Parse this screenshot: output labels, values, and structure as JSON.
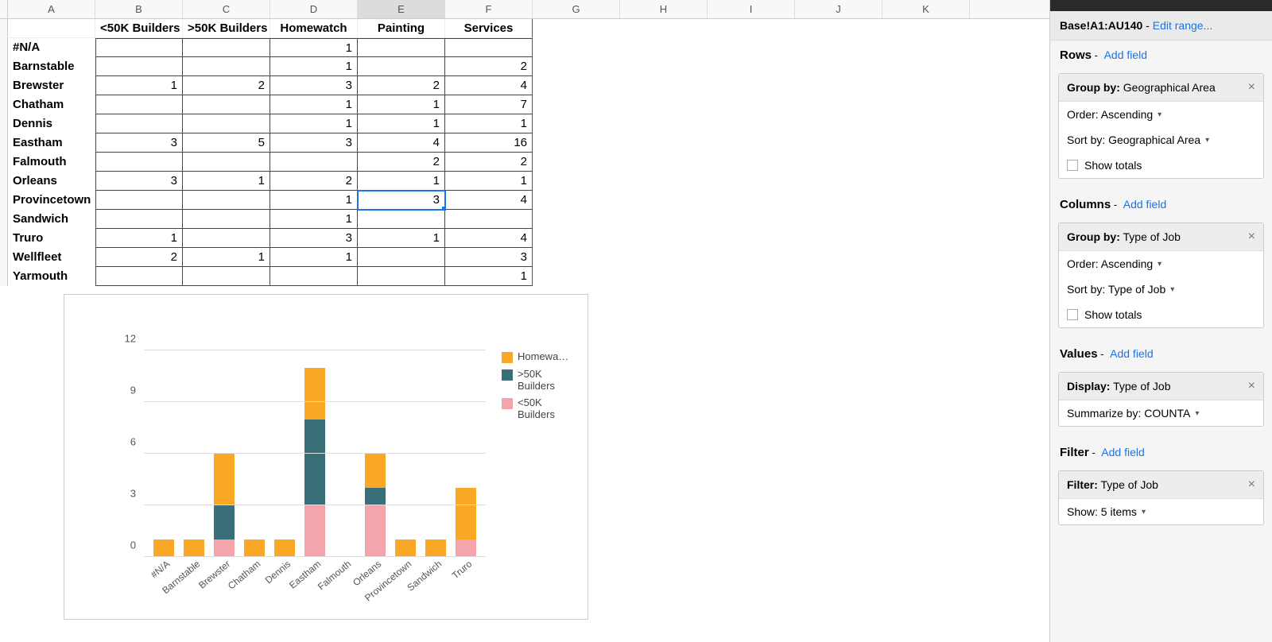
{
  "sidebar": {
    "range_label": "Base!A1:AU140",
    "range_suffix": " - ",
    "edit_range": "Edit range...",
    "rows_label": "Rows",
    "columns_label": "Columns",
    "values_label": "Values",
    "filter_label": "Filter",
    "add_field": "Add field",
    "group_row_label": "Group by:",
    "group_row_value": "Geographical Area",
    "order_label": "Order: Ascending",
    "sort_row_label": "Sort by: Geographical Area",
    "show_totals": "Show totals",
    "group_col_label": "Group by:",
    "group_col_value": "Type of Job",
    "sort_col_label": "Sort by: Type of Job",
    "display_label": "Display:",
    "display_value": "Type of Job",
    "summarize_label": "Summarize by: COUNTA",
    "filter_box_label": "Filter:",
    "filter_box_value": "Type of Job",
    "show_label": "Show: 5 items"
  },
  "columns": [
    "A",
    "B",
    "C",
    "D",
    "E",
    "F",
    "G",
    "H",
    "I",
    "J",
    "K"
  ],
  "selected_col": "E",
  "pivot": {
    "headers": [
      "",
      "<50K Builders",
      ">50K Builders",
      "Homewatch",
      "Painting",
      "Services"
    ],
    "rows": [
      {
        "label": "#N/A",
        "v": [
          "",
          "",
          "1",
          "",
          ""
        ]
      },
      {
        "label": "Barnstable",
        "v": [
          "",
          "",
          "1",
          "",
          "2"
        ]
      },
      {
        "label": "Brewster",
        "v": [
          "1",
          "2",
          "3",
          "2",
          "4"
        ]
      },
      {
        "label": "Chatham",
        "v": [
          "",
          "",
          "1",
          "1",
          "7"
        ]
      },
      {
        "label": "Dennis",
        "v": [
          "",
          "",
          "1",
          "1",
          "1"
        ]
      },
      {
        "label": "Eastham",
        "v": [
          "3",
          "5",
          "3",
          "4",
          "16"
        ]
      },
      {
        "label": "Falmouth",
        "v": [
          "",
          "",
          "",
          "2",
          "2"
        ]
      },
      {
        "label": "Orleans",
        "v": [
          "3",
          "1",
          "2",
          "1",
          "1"
        ]
      },
      {
        "label": "Provincetown",
        "v": [
          "",
          "",
          "1",
          "3",
          "4"
        ]
      },
      {
        "label": "Sandwich",
        "v": [
          "",
          "",
          "1",
          "",
          ""
        ]
      },
      {
        "label": "Truro",
        "v": [
          "1",
          "",
          "3",
          "1",
          "4"
        ]
      },
      {
        "label": "Wellfleet",
        "v": [
          "2",
          "1",
          "1",
          "",
          "3"
        ]
      },
      {
        "label": "Yarmouth",
        "v": [
          "",
          "",
          "",
          "",
          "1"
        ]
      }
    ]
  },
  "chart_data": {
    "type": "bar",
    "stacked": true,
    "categories": [
      "#N/A",
      "Barnstable",
      "Brewster",
      "Chatham",
      "Dennis",
      "Eastham",
      "Falmouth",
      "Orleans",
      "Provincetown",
      "Sandwich",
      "Truro"
    ],
    "series": [
      {
        "name": "Homewa…",
        "full_name": "Homewatch",
        "values": [
          1,
          1,
          3,
          1,
          1,
          3,
          0,
          2,
          1,
          1,
          3
        ],
        "color": "#f9a825"
      },
      {
        "name": ">50K Builders",
        "values": [
          0,
          0,
          2,
          0,
          0,
          5,
          0,
          1,
          0,
          0,
          0
        ],
        "color": "#3a6f7a"
      },
      {
        "name": "<50K Builders",
        "values": [
          0,
          0,
          1,
          0,
          0,
          3,
          0,
          3,
          0,
          0,
          1
        ],
        "color": "#f4a4ab"
      }
    ],
    "yticks": [
      0,
      3,
      6,
      9,
      12
    ],
    "ylim": [
      0,
      12
    ]
  }
}
